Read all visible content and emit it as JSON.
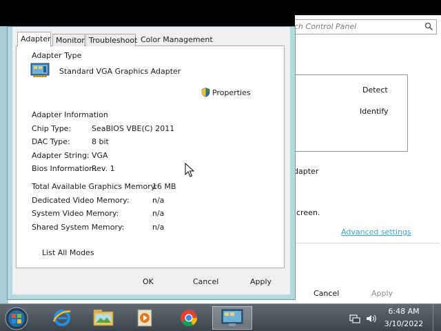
{
  "background_window": {
    "search_placeholder": "ch Control Panel",
    "detect_label": "Detect",
    "identify_label": "Identify",
    "adapter_fragment": "dapter",
    "screen_fragment": "creen.",
    "advanced_settings_link": "Advanced settings",
    "cancel_label": "Cancel",
    "apply_label": "Apply"
  },
  "dialog": {
    "tabs": [
      {
        "label": "Adapter",
        "active": true
      },
      {
        "label": "Monitor"
      },
      {
        "label": "Troubleshoot"
      },
      {
        "label": "Color Management"
      }
    ],
    "adapter_type_heading": "Adapter Type",
    "adapter_name": "Standard VGA Graphics Adapter",
    "properties_button": "Properties",
    "adapter_info_heading": "Adapter Information",
    "info_rows": [
      {
        "label": "Chip Type:",
        "value": "SeaBIOS VBE(C) 2011"
      },
      {
        "label": "DAC Type:",
        "value": "8 bit"
      },
      {
        "label": "Adapter String:",
        "value": "VGA"
      },
      {
        "label": "Bios Information:",
        "value": "Rev. 1"
      }
    ],
    "memory_rows": [
      {
        "label": "Total Available Graphics Memory:",
        "value": "16 MB"
      },
      {
        "label": "Dedicated Video Memory:",
        "value": "n/a"
      },
      {
        "label": "System Video Memory:",
        "value": "n/a"
      },
      {
        "label": "Shared System Memory:",
        "value": "n/a"
      }
    ],
    "list_all_modes_button": "List All Modes",
    "ok_button": "OK",
    "cancel_button": "Cancel",
    "apply_button": "Apply"
  },
  "taskbar": {
    "apps": [
      "internet-explorer-icon",
      "file-explorer-icon",
      "media-player-icon",
      "chrome-icon",
      "control-panel-icon"
    ],
    "time": "6:48 AM",
    "date": "3/10/2022"
  }
}
